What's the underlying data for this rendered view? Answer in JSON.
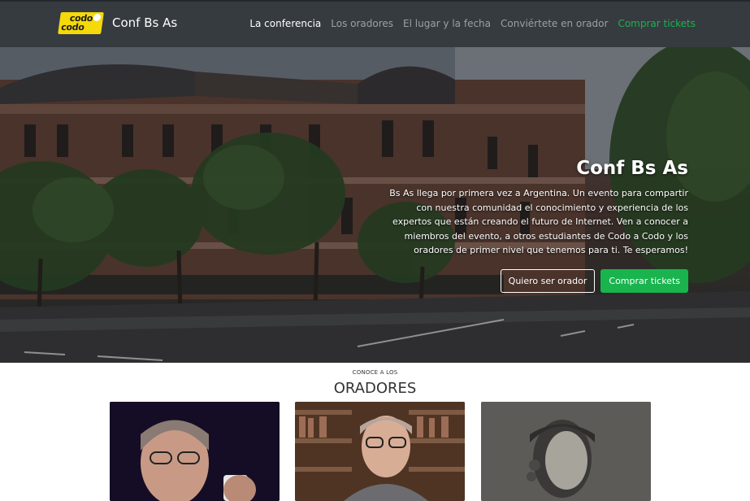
{
  "brand": {
    "logo_line1": "codo",
    "logo_line2": "codo",
    "name": "Conf Bs As"
  },
  "nav": {
    "items": [
      {
        "label": "La conferencia"
      },
      {
        "label": "Los oradores"
      },
      {
        "label": "El lugar y la fecha"
      },
      {
        "label": "Conviértete en orador"
      },
      {
        "label": "Comprar tickets"
      }
    ]
  },
  "hero": {
    "title": "Conf Bs As",
    "text": "Bs As llega por primera vez a Argentina. Un evento para compartir con nuestra comunidad el conocimiento y experiencia de los expertos que están creando el futuro de Internet. Ven a conocer a miembros del evento, a otros estudiantes de Codo a Codo y los oradores de primer nivel que tenemos para ti. Te esperamos!",
    "btn_speaker": "Quiero ser orador",
    "btn_tickets": "Comprar tickets"
  },
  "speakers": {
    "kicker": "CONOCE A LOS",
    "title": "ORADORES"
  },
  "colors": {
    "navbar": "#363b40",
    "accent_green": "#19b44e",
    "logo_yellow": "#f5d90a"
  }
}
